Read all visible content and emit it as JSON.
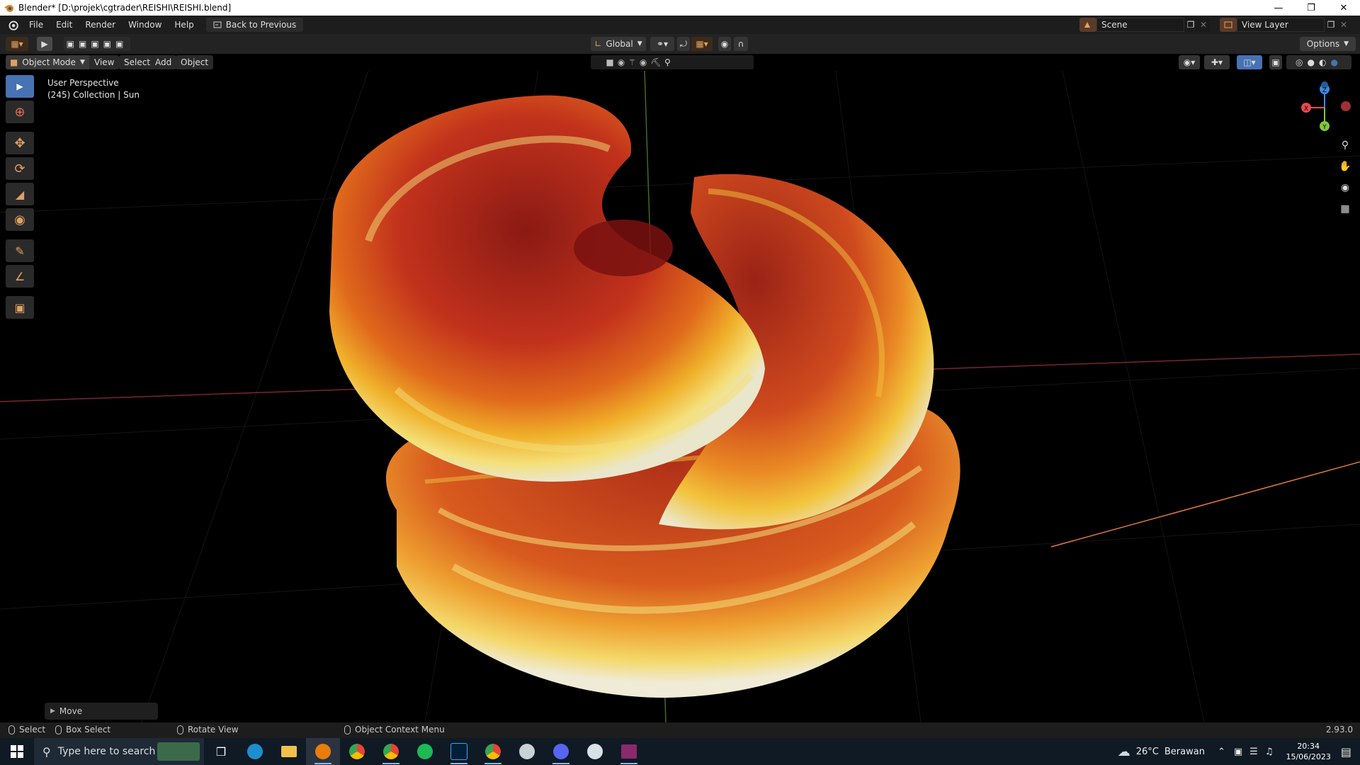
{
  "window": {
    "title": "Blender* [D:\\projek\\cgtrader\\REISHI\\REISHI.blend]",
    "controls": [
      "minimize-icon",
      "restore-icon",
      "close-icon"
    ]
  },
  "menubar": {
    "items": [
      "File",
      "Edit",
      "Render",
      "Window",
      "Help"
    ],
    "back_label": "Back to Previous",
    "scene_name": "Scene",
    "view_layer_name": "View Layer"
  },
  "toolheader": {
    "orientation": "Global",
    "options_label": "Options"
  },
  "viewheader": {
    "mode": "Object Mode",
    "menus": [
      "View",
      "Select",
      "Add",
      "Object"
    ]
  },
  "viewport": {
    "perspective_label": "User Perspective",
    "collection_label": "(245) Collection | Sun",
    "axes": {
      "x": "X",
      "y": "Y",
      "z": "Z"
    }
  },
  "last_operator": {
    "label": "Move"
  },
  "statusbar": {
    "select": "Select",
    "box_select": "Box Select",
    "rotate_view": "Rotate View",
    "context_menu": "Object Context Menu",
    "version": "2.93.0"
  },
  "taskbar": {
    "search_placeholder": "Type here to search",
    "weather_temp": "26°C",
    "weather_text": "Berawan",
    "time": "20:34",
    "date": "15/06/2023"
  },
  "colors": {
    "accent": "#4772b3",
    "axis_x": "#e8484f",
    "axis_y": "#7ec93a",
    "axis_z": "#3d8ae8"
  }
}
